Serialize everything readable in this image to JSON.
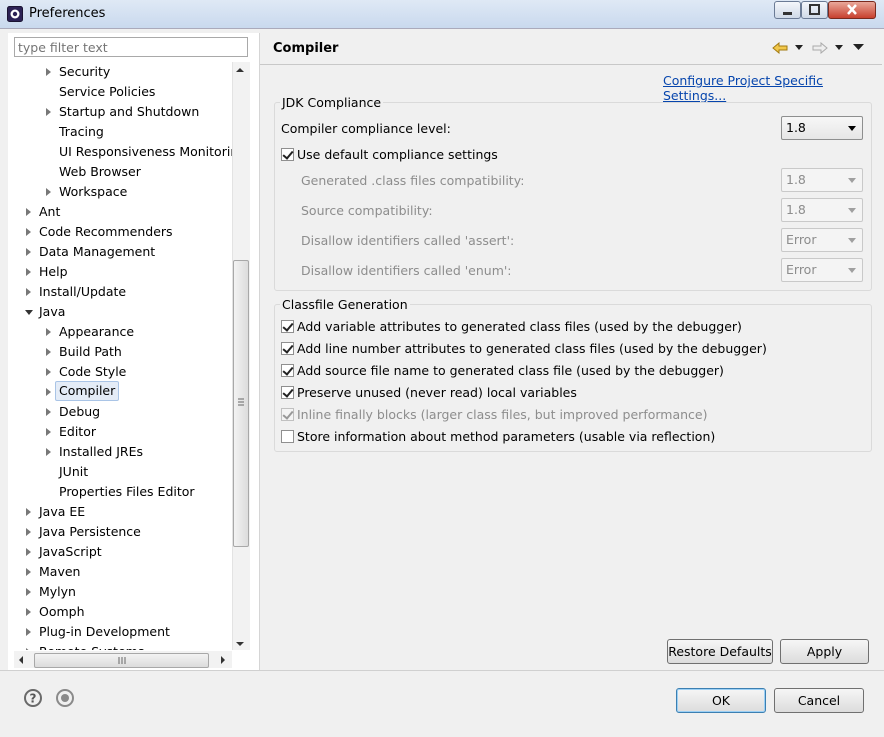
{
  "window": {
    "title": "Preferences",
    "accent": "#3c7fb1"
  },
  "sidebar": {
    "filter_placeholder": "type filter text",
    "tree": [
      {
        "label": "Security",
        "level": 2,
        "twisty": "closed"
      },
      {
        "label": "Service Policies",
        "level": 2,
        "twisty": "none"
      },
      {
        "label": "Startup and Shutdown",
        "level": 2,
        "twisty": "closed"
      },
      {
        "label": "Tracing",
        "level": 2,
        "twisty": "none"
      },
      {
        "label": "UI Responsiveness Monitoring",
        "level": 2,
        "twisty": "none"
      },
      {
        "label": "Web Browser",
        "level": 2,
        "twisty": "none"
      },
      {
        "label": "Workspace",
        "level": 2,
        "twisty": "closed"
      },
      {
        "label": "Ant",
        "level": 1,
        "twisty": "closed"
      },
      {
        "label": "Code Recommenders",
        "level": 1,
        "twisty": "closed"
      },
      {
        "label": "Data Management",
        "level": 1,
        "twisty": "closed"
      },
      {
        "label": "Help",
        "level": 1,
        "twisty": "closed"
      },
      {
        "label": "Install/Update",
        "level": 1,
        "twisty": "closed"
      },
      {
        "label": "Java",
        "level": 1,
        "twisty": "open"
      },
      {
        "label": "Appearance",
        "level": 2,
        "twisty": "closed"
      },
      {
        "label": "Build Path",
        "level": 2,
        "twisty": "closed"
      },
      {
        "label": "Code Style",
        "level": 2,
        "twisty": "closed"
      },
      {
        "label": "Compiler",
        "level": 2,
        "twisty": "closed",
        "selected": true
      },
      {
        "label": "Debug",
        "level": 2,
        "twisty": "closed"
      },
      {
        "label": "Editor",
        "level": 2,
        "twisty": "closed"
      },
      {
        "label": "Installed JREs",
        "level": 2,
        "twisty": "closed"
      },
      {
        "label": "JUnit",
        "level": 2,
        "twisty": "none"
      },
      {
        "label": "Properties Files Editor",
        "level": 2,
        "twisty": "none"
      },
      {
        "label": "Java EE",
        "level": 1,
        "twisty": "closed"
      },
      {
        "label": "Java Persistence",
        "level": 1,
        "twisty": "closed"
      },
      {
        "label": "JavaScript",
        "level": 1,
        "twisty": "closed"
      },
      {
        "label": "Maven",
        "level": 1,
        "twisty": "closed"
      },
      {
        "label": "Mylyn",
        "level": 1,
        "twisty": "closed"
      },
      {
        "label": "Oomph",
        "level": 1,
        "twisty": "closed"
      },
      {
        "label": "Plug-in Development",
        "level": 1,
        "twisty": "closed"
      },
      {
        "label": "Remote Systems",
        "level": 1,
        "twisty": "closed"
      }
    ]
  },
  "main": {
    "title": "Compiler",
    "configure_link": "Configure Project Specific Settings...",
    "jdk": {
      "group_label": "JDK Compliance",
      "compliance_label": "Compiler compliance level:",
      "compliance_value": "1.8",
      "use_default_label": "Use default compliance settings",
      "use_default_checked": true,
      "class_compat_label": "Generated .class files compatibility:",
      "class_compat_value": "1.8",
      "source_compat_label": "Source compatibility:",
      "source_compat_value": "1.8",
      "assert_label": "Disallow identifiers called 'assert':",
      "assert_value": "Error",
      "enum_label": "Disallow identifiers called 'enum':",
      "enum_value": "Error"
    },
    "classfile": {
      "group_label": "Classfile Generation",
      "options": [
        {
          "label": "Add variable attributes to generated class files (used by the debugger)",
          "checked": true,
          "enabled": true
        },
        {
          "label": "Add line number attributes to generated class files (used by the debugger)",
          "checked": true,
          "enabled": true
        },
        {
          "label": "Add source file name to generated class file (used by the debugger)",
          "checked": true,
          "enabled": true
        },
        {
          "label": "Preserve unused (never read) local variables",
          "checked": true,
          "enabled": true
        },
        {
          "label": "Inline finally blocks (larger class files, but improved performance)",
          "checked": true,
          "enabled": false
        },
        {
          "label": "Store information about method parameters (usable via reflection)",
          "checked": false,
          "enabled": true
        }
      ]
    },
    "restore_defaults_label": "Restore Defaults",
    "apply_label": "Apply"
  },
  "footer": {
    "ok_label": "OK",
    "cancel_label": "Cancel",
    "help_icon": "help-icon",
    "oomph_icon": "oomph-record-icon"
  }
}
